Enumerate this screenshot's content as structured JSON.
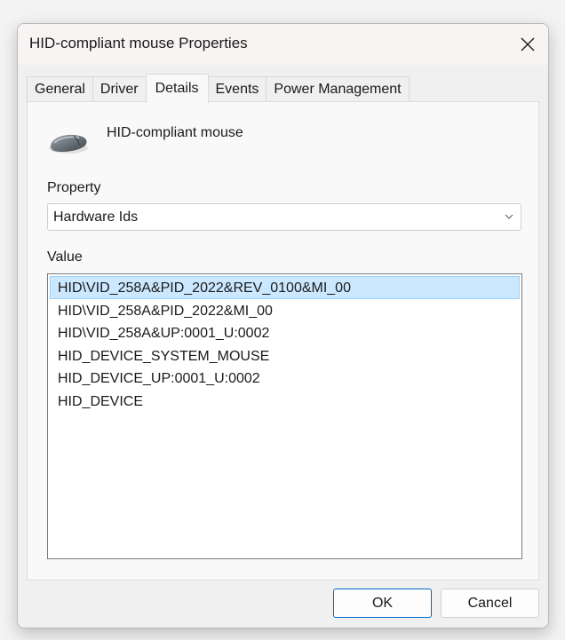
{
  "window": {
    "title": "HID-compliant mouse Properties"
  },
  "tabs": [
    {
      "label": "General"
    },
    {
      "label": "Driver"
    },
    {
      "label": "Details"
    },
    {
      "label": "Events"
    },
    {
      "label": "Power Management"
    }
  ],
  "active_tab": "Details",
  "device": {
    "name": "HID-compliant mouse",
    "icon": "mouse-icon"
  },
  "property": {
    "label": "Property",
    "selected": "Hardware Ids"
  },
  "value": {
    "label": "Value",
    "items": [
      "HID\\VID_258A&PID_2022&REV_0100&MI_00",
      "HID\\VID_258A&PID_2022&MI_00",
      "HID\\VID_258A&UP:0001_U:0002",
      "HID_DEVICE_SYSTEM_MOUSE",
      "HID_DEVICE_UP:0001_U:0002",
      "HID_DEVICE"
    ],
    "selected_index": 0
  },
  "buttons": {
    "ok": "OK",
    "cancel": "Cancel"
  },
  "colors": {
    "selection_bg": "#cce8ff",
    "selection_border": "#99d1ff",
    "default_button_border": "#0067c0"
  }
}
